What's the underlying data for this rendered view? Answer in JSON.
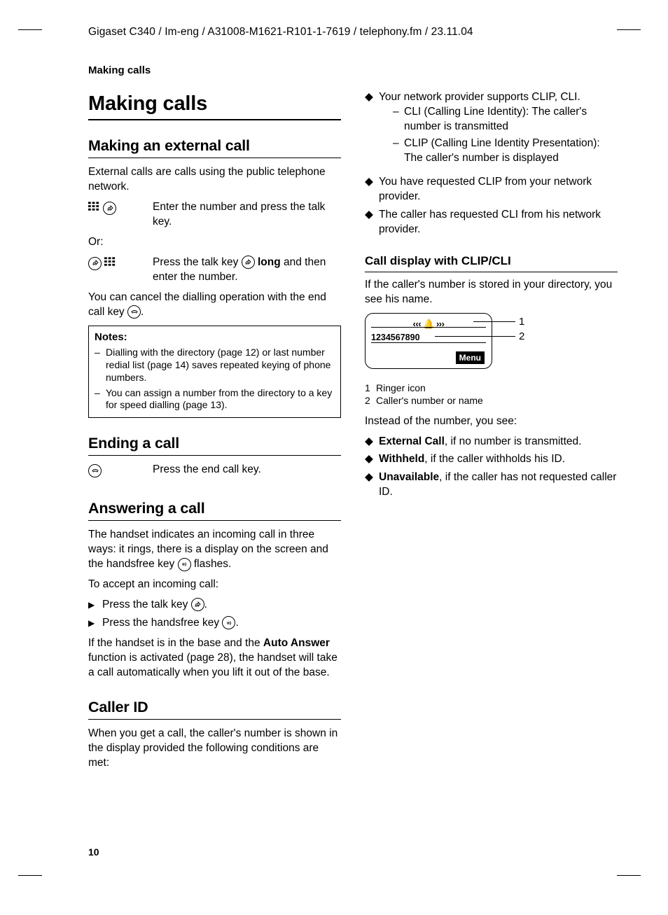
{
  "header_path": "Gigaset C340 / Im-eng / A31008-M1621-R101-1-7619 / telephony.fm / 23.11.04",
  "section_header": "Making calls",
  "page_number": "10",
  "col1": {
    "h1": "Making calls",
    "s1": {
      "title": "Making an external call",
      "intro": "External calls are calls using the public telephone network.",
      "step1": "Enter the number and press the talk key.",
      "or": "Or:",
      "step2a": "Press the talk key ",
      "step2b": " long",
      "step2c": " and then enter the number.",
      "cancel": "You can cancel the dialling operation with the end call key ",
      "cancel_end": "."
    },
    "notes": {
      "title": "Notes:",
      "n1": "Dialling with the directory (page 12) or last number redial list (page 14) saves repeated keying of phone numbers.",
      "n2": "You can assign a number from the directory to a key for speed dialling (page 13)."
    },
    "s2": {
      "title": "Ending a call",
      "step": "Press the end call key."
    },
    "s3": {
      "title": "Answering a call",
      "p1a": "The handset indicates an incoming call in three ways: it rings, there is a display on the screen and the handsfree key ",
      "p1b": " flashes.",
      "p2": "To accept an incoming call:",
      "b1a": "Press the talk key ",
      "b1b": ".",
      "b2a": "Press the handsfree key ",
      "b2b": ".",
      "p3a": "If the handset is in the base and the ",
      "p3auto": "Auto Answer",
      "p3b": " function is activated (page 28), the handset will take a call automatically when you lift it out of the base."
    },
    "s4": {
      "title": "Caller ID",
      "p1": "When you get a call, the caller's number is shown in the display provided the following conditions are met:"
    }
  },
  "col2": {
    "d1": "Your network provider supports CLIP, CLI.",
    "d1a": "CLI (Calling Line Identity): The caller's number is transmitted",
    "d1b": "CLIP (Calling Line Identity Presentation): The caller's number is displayed",
    "d2": "You have requested CLIP from your network provider.",
    "d3": "The caller has requested CLI from his network provider.",
    "s1": {
      "title": "Call display with CLIP/CLI",
      "p1": "If the caller's number is stored in your directory, you see his name.",
      "screen": {
        "ringer": "‹‹‹ 🔔 ›››",
        "number": "1234567890",
        "menu": "Menu"
      },
      "callout1": "1",
      "callout2": "2",
      "legend1": "Ringer icon",
      "legend2": "Caller's number or name",
      "p2": "Instead of the number, you see:",
      "b1lbl": "External Call",
      "b1txt": ", if no number is transmitted.",
      "b2lbl": "Withheld",
      "b2txt": ", if the caller withholds his ID.",
      "b3lbl": "Unavailable",
      "b3txt": ", if the caller has not requested caller ID."
    }
  }
}
